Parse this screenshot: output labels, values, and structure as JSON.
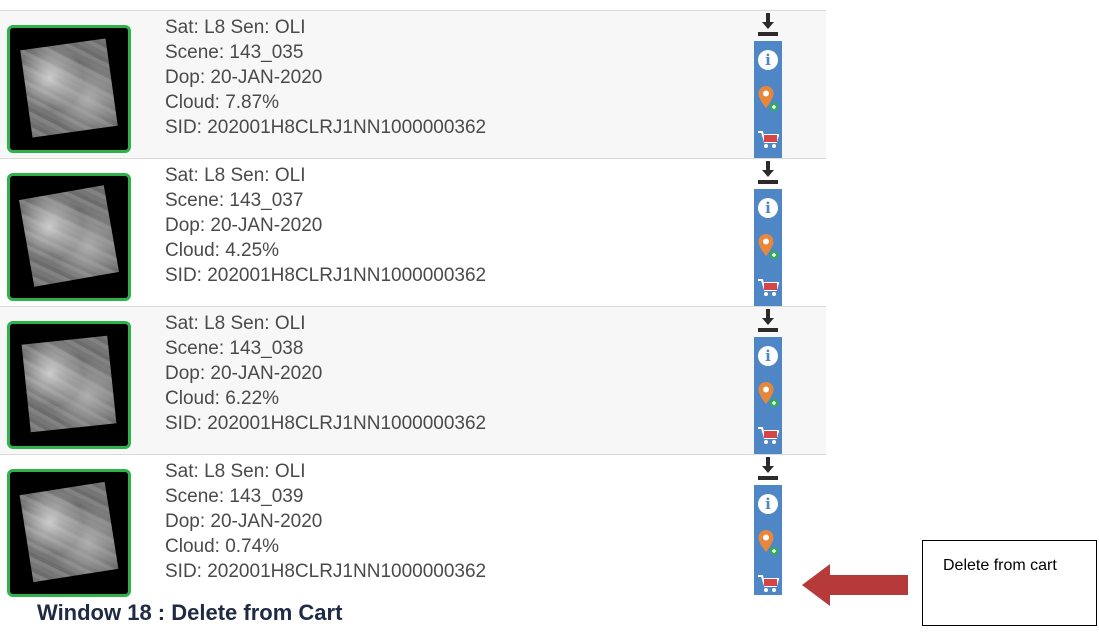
{
  "results": [
    {
      "sat": "Sat: L8 Sen: OLI",
      "scene": "Scene: 143_035",
      "dop": "Dop: 20-JAN-2020",
      "cloud": "Cloud: 7.87%",
      "sid": "SID: 202001H8CLRJ1NN1000000362"
    },
    {
      "sat": "Sat: L8 Sen: OLI",
      "scene": "Scene: 143_037",
      "dop": "Dop: 20-JAN-2020",
      "cloud": "Cloud: 4.25%",
      "sid": "SID: 202001H8CLRJ1NN1000000362"
    },
    {
      "sat": "Sat: L8 Sen: OLI",
      "scene": "Scene: 143_038",
      "dop": "Dop: 20-JAN-2020",
      "cloud": "Cloud: 6.22%",
      "sid": "SID: 202001H8CLRJ1NN1000000362"
    },
    {
      "sat": "Sat: L8 Sen: OLI",
      "scene": "Scene: 143_039",
      "dop": "Dop: 20-JAN-2020",
      "cloud": "Cloud: 0.74%",
      "sid": "SID: 202001H8CLRJ1NN1000000362"
    }
  ],
  "icons": {
    "download": "download-icon",
    "info": "info-icon",
    "location": "map-pin-icon",
    "cart": "cart-icon"
  },
  "callout": {
    "text": "Delete from cart"
  },
  "caption": "Window 18 : Delete from Cart",
  "colors": {
    "thumbnail_border": "#2fb24a",
    "action_bar": "#4f87c6",
    "arrow": "#b73a3a",
    "pin": "#e8873a",
    "cart": "#d64545"
  }
}
